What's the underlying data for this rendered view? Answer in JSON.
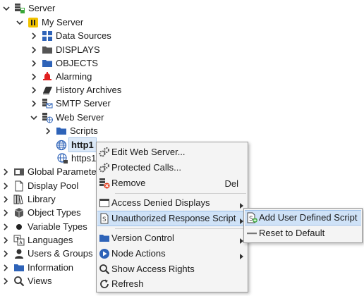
{
  "tree": [
    {
      "label": "Server",
      "chevron": "down",
      "icon": "server-icon"
    },
    {
      "label": "My Server",
      "chevron": "down",
      "icon": "my-server-icon"
    },
    {
      "label": "Data Sources",
      "chevron": "right",
      "icon": "data-sources-icon"
    },
    {
      "label": "DISPLAYS",
      "chevron": "right",
      "icon": "folder-gray-icon"
    },
    {
      "label": "OBJECTS",
      "chevron": "right",
      "icon": "folder-blue-icon"
    },
    {
      "label": "Alarming",
      "chevron": "right",
      "icon": "bell-icon"
    },
    {
      "label": "History Archives",
      "chevron": "right",
      "icon": "book-icon"
    },
    {
      "label": "SMTP Server",
      "chevron": "right",
      "icon": "smtp-server-icon"
    },
    {
      "label": "Web Server",
      "chevron": "down",
      "icon": "web-server-icon"
    },
    {
      "label": "Scripts",
      "chevron": "right",
      "icon": "folder-blue-icon"
    },
    {
      "label": "http1",
      "chevron": "",
      "icon": "globe-icon"
    },
    {
      "label": "https1",
      "chevron": "",
      "icon": "globe-lock-icon"
    },
    {
      "label": "Global Parameters",
      "chevron": "right",
      "icon": "global-params-icon"
    },
    {
      "label": "Display Pool",
      "chevron": "right",
      "icon": "document-icon"
    },
    {
      "label": "Library",
      "chevron": "right",
      "icon": "library-icon"
    },
    {
      "label": "Object Types",
      "chevron": "right",
      "icon": "cube-icon"
    },
    {
      "label": "Variable Types",
      "chevron": "right",
      "icon": "dot-icon"
    },
    {
      "label": "Languages",
      "chevron": "right",
      "icon": "languages-icon"
    },
    {
      "label": "Users & Groups",
      "chevron": "right",
      "icon": "user-icon"
    },
    {
      "label": "Information",
      "chevron": "right",
      "icon": "folder-blue-icon"
    },
    {
      "label": "Views",
      "chevron": "right",
      "icon": "magnifier-icon"
    }
  ],
  "context_menu": {
    "edit_web_server": "Edit Web Server...",
    "protected_calls": "Protected Calls...",
    "remove": "Remove",
    "remove_shortcut": "Del",
    "access_denied_displays": "Access Denied Displays",
    "unauthorized_response_script": "Unauthorized Response Script",
    "version_control": "Version Control",
    "node_actions": "Node Actions",
    "show_access_rights": "Show Access Rights",
    "refresh": "Refresh"
  },
  "submenu": {
    "add_user_defined_script": "Add User Defined Script",
    "reset_to_default": "Reset to Default"
  },
  "colors": {
    "highlight": "#cfe2f7",
    "folder_blue": "#2e63b8",
    "folder_gray": "#555555",
    "alarm_red": "#e02020"
  }
}
